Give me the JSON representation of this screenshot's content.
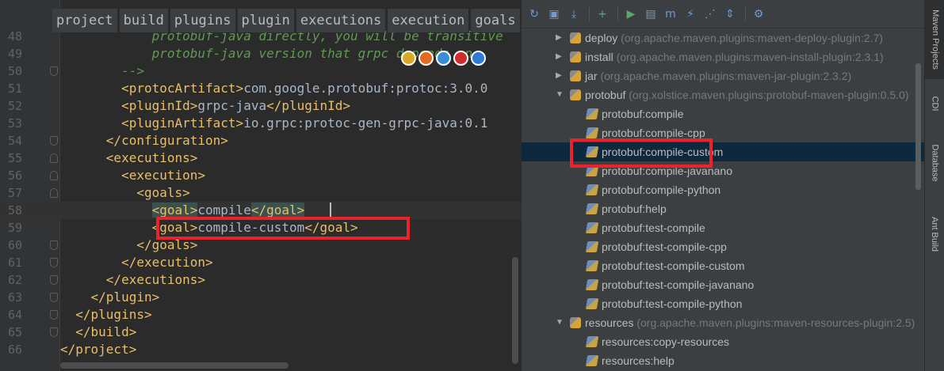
{
  "editor": {
    "breadcrumbs": [
      "project",
      "build",
      "plugins",
      "plugin",
      "executions",
      "execution",
      "goals"
    ],
    "lines": [
      {
        "num": "48",
        "tokens": [
          {
            "t": "cmt",
            "v": "            protobuf-java directly, you will be transitive"
          }
        ]
      },
      {
        "num": "49",
        "tokens": [
          {
            "t": "cmt",
            "v": "            protobuf-java version that grpc depends on."
          }
        ]
      },
      {
        "num": "50",
        "tokens": [
          {
            "t": "cmt",
            "v": "        -->"
          }
        ]
      },
      {
        "num": "51",
        "tokens": [
          {
            "t": "txt",
            "v": "        "
          },
          {
            "t": "tag",
            "v": "<protocArtifact>"
          },
          {
            "t": "txt",
            "v": "com.google.protobuf:protoc:3.0.0"
          }
        ]
      },
      {
        "num": "52",
        "tokens": [
          {
            "t": "txt",
            "v": "        "
          },
          {
            "t": "tag",
            "v": "<pluginId>"
          },
          {
            "t": "txt",
            "v": "grpc-java"
          },
          {
            "t": "tag",
            "v": "</pluginId>"
          }
        ]
      },
      {
        "num": "53",
        "tokens": [
          {
            "t": "txt",
            "v": "        "
          },
          {
            "t": "tag",
            "v": "<pluginArtifact>"
          },
          {
            "t": "txt",
            "v": "io.grpc:protoc-gen-grpc-java:0.1"
          }
        ]
      },
      {
        "num": "54",
        "tokens": [
          {
            "t": "txt",
            "v": "      "
          },
          {
            "t": "tag",
            "v": "</configuration>"
          }
        ]
      },
      {
        "num": "55",
        "tokens": [
          {
            "t": "txt",
            "v": "      "
          },
          {
            "t": "tag",
            "v": "<executions>"
          }
        ]
      },
      {
        "num": "56",
        "tokens": [
          {
            "t": "txt",
            "v": "        "
          },
          {
            "t": "tag",
            "v": "<execution>"
          }
        ]
      },
      {
        "num": "57",
        "tokens": [
          {
            "t": "txt",
            "v": "          "
          },
          {
            "t": "tag",
            "v": "<goals>"
          }
        ]
      },
      {
        "num": "58",
        "current": true,
        "tokens": [
          {
            "t": "txt",
            "v": "            "
          },
          {
            "t": "tag hl-tag",
            "v": "<goal>"
          },
          {
            "t": "txt",
            "v": "compile"
          },
          {
            "t": "tag hl-tag",
            "v": "</goal>"
          }
        ]
      },
      {
        "num": "59",
        "tokens": [
          {
            "t": "txt",
            "v": "            "
          },
          {
            "t": "tag",
            "v": "<goal>"
          },
          {
            "t": "txt",
            "v": "compile-custom"
          },
          {
            "t": "tag",
            "v": "</goal>"
          }
        ]
      },
      {
        "num": "60",
        "tokens": [
          {
            "t": "txt",
            "v": "          "
          },
          {
            "t": "tag",
            "v": "</goals>"
          }
        ]
      },
      {
        "num": "61",
        "tokens": [
          {
            "t": "txt",
            "v": "        "
          },
          {
            "t": "tag",
            "v": "</execution>"
          }
        ]
      },
      {
        "num": "62",
        "tokens": [
          {
            "t": "txt",
            "v": "      "
          },
          {
            "t": "tag",
            "v": "</executions>"
          }
        ]
      },
      {
        "num": "63",
        "tokens": [
          {
            "t": "txt",
            "v": "    "
          },
          {
            "t": "tag",
            "v": "</plugin>"
          }
        ]
      },
      {
        "num": "64",
        "tokens": [
          {
            "t": "txt",
            "v": "  "
          },
          {
            "t": "tag",
            "v": "</plugins>"
          }
        ]
      },
      {
        "num": "65",
        "tokens": [
          {
            "t": "txt",
            "v": "  "
          },
          {
            "t": "tag",
            "v": "</build>"
          }
        ]
      },
      {
        "num": "66",
        "tokens": [
          {
            "t": "tag",
            "v": "</project>"
          }
        ]
      }
    ],
    "browser_icons": [
      {
        "name": "chrome-icon",
        "color": "#d9a925"
      },
      {
        "name": "firefox-icon",
        "color": "#e56a1f"
      },
      {
        "name": "safari-icon",
        "color": "#3a8ed8"
      },
      {
        "name": "opera-icon",
        "color": "#d22b2b"
      },
      {
        "name": "ie-icon",
        "color": "#2f7ad6"
      }
    ]
  },
  "maven": {
    "toolbar": [
      {
        "name": "reimport-icon",
        "glyph": "↻"
      },
      {
        "name": "generate-sources-icon",
        "glyph": "▣"
      },
      {
        "name": "download-icon",
        "glyph": "⤓"
      },
      {
        "name": "sep"
      },
      {
        "name": "add-icon",
        "glyph": "+",
        "color": "#59a869"
      },
      {
        "name": "sep"
      },
      {
        "name": "run-icon",
        "glyph": "▶",
        "color": "#59a869"
      },
      {
        "name": "run-config-icon",
        "glyph": "▤"
      },
      {
        "name": "toggle-offline-icon",
        "glyph": "m"
      },
      {
        "name": "skip-tests-icon",
        "glyph": "⚡"
      },
      {
        "name": "show-dependencies-icon",
        "glyph": "⋰"
      },
      {
        "name": "collapse-all-icon",
        "glyph": "⇕"
      },
      {
        "name": "sep"
      },
      {
        "name": "settings-icon",
        "glyph": "⚙"
      }
    ],
    "rows": [
      {
        "kind": "plugin",
        "arrow": "▶",
        "name": "deploy",
        "coord": "(org.apache.maven.plugins:maven-deploy-plugin:2.7)"
      },
      {
        "kind": "plugin",
        "arrow": "▶",
        "name": "install",
        "coord": "(org.apache.maven.plugins:maven-install-plugin:2.3.1)"
      },
      {
        "kind": "plugin",
        "arrow": "▶",
        "name": "jar",
        "coord": "(org.apache.maven.plugins:maven-jar-plugin:2.3.2)"
      },
      {
        "kind": "plugin",
        "arrow": "▼",
        "name": "protobuf",
        "coord": "(org.xolstice.maven.plugins:protobuf-maven-plugin:0.5.0)"
      },
      {
        "kind": "goal",
        "name": "protobuf:compile"
      },
      {
        "kind": "goal",
        "name": "protobuf:compile-cpp"
      },
      {
        "kind": "goal",
        "name": "protobuf:compile-custom",
        "selected": true
      },
      {
        "kind": "goal",
        "name": "protobuf:compile-javanano"
      },
      {
        "kind": "goal",
        "name": "protobuf:compile-python"
      },
      {
        "kind": "goal",
        "name": "protobuf:help"
      },
      {
        "kind": "goal",
        "name": "protobuf:test-compile"
      },
      {
        "kind": "goal",
        "name": "protobuf:test-compile-cpp"
      },
      {
        "kind": "goal",
        "name": "protobuf:test-compile-custom"
      },
      {
        "kind": "goal",
        "name": "protobuf:test-compile-javanano"
      },
      {
        "kind": "goal",
        "name": "protobuf:test-compile-python"
      },
      {
        "kind": "plugin",
        "arrow": "▼",
        "name": "resources",
        "coord": "(org.apache.maven.plugins:maven-resources-plugin:2.5)"
      },
      {
        "kind": "goal",
        "name": "resources:copy-resources"
      },
      {
        "kind": "goal",
        "name": "resources:help"
      }
    ]
  },
  "strip": {
    "tabs": [
      "Maven Projects",
      "CDI",
      "Database",
      "Ant Build"
    ]
  },
  "colors": {
    "highlight_box": "#e8232b",
    "selection": "#0d293e"
  }
}
